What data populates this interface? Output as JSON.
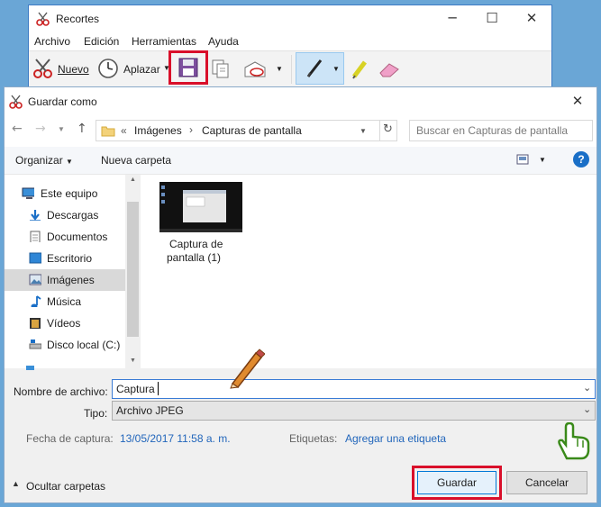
{
  "snipping_tool": {
    "title": "Recortes",
    "menu": [
      "Archivo",
      "Edición",
      "Herramientas",
      "Ayuda"
    ],
    "toolbar": {
      "new_label": "Nuevo",
      "delay_label": "Aplazar"
    }
  },
  "dialog": {
    "title": "Guardar como",
    "breadcrumb": {
      "prefix": "«",
      "items": [
        "Imágenes",
        "Capturas de pantalla"
      ]
    },
    "search_placeholder": "Buscar en Capturas de pantalla",
    "commands": {
      "organize": "Organizar",
      "new_folder": "Nueva carpeta"
    },
    "nav_items": [
      {
        "label": "Este equipo",
        "icon": "computer-icon"
      },
      {
        "label": "Descargas",
        "icon": "download-icon"
      },
      {
        "label": "Documentos",
        "icon": "document-icon"
      },
      {
        "label": "Escritorio",
        "icon": "desktop-icon"
      },
      {
        "label": "Imágenes",
        "icon": "pictures-icon",
        "selected": true
      },
      {
        "label": "Música",
        "icon": "music-icon"
      },
      {
        "label": "Vídeos",
        "icon": "video-icon"
      },
      {
        "label": "Disco local (C:)",
        "icon": "drive-icon"
      }
    ],
    "files": [
      {
        "name_line1": "Captura de",
        "name_line2": "pantalla (1)"
      }
    ],
    "filename_label": "Nombre de archivo:",
    "filename_value": "Captura",
    "type_label": "Tipo:",
    "type_value": "Archivo JPEG",
    "date_label": "Fecha de captura:",
    "date_value": "13/05/2017 11:58 a. m.",
    "tags_label": "Etiquetas:",
    "tags_link": "Agregar una etiqueta",
    "hide_folders": "Ocultar carpetas",
    "save_button": "Guardar",
    "cancel_button": "Cancelar"
  },
  "colors": {
    "highlight": "#d90f2a",
    "accent": "#2266bb",
    "selected_bg": "#d9d9d9"
  }
}
